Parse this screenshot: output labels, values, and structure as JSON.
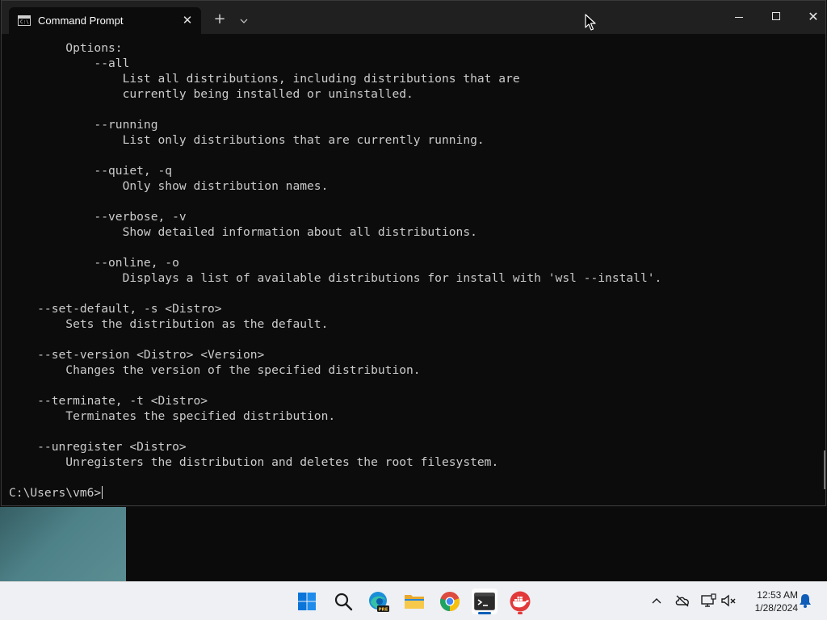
{
  "window": {
    "tab_title": "Command Prompt",
    "tab_icon_text": "C:\\"
  },
  "console": {
    "lines": [
      "        Options:",
      "            --all",
      "                List all distributions, including distributions that are",
      "                currently being installed or uninstalled.",
      "",
      "            --running",
      "                List only distributions that are currently running.",
      "",
      "            --quiet, -q",
      "                Only show distribution names.",
      "",
      "            --verbose, -v",
      "                Show detailed information about all distributions.",
      "",
      "            --online, -o",
      "                Displays a list of available distributions for install with 'wsl --install'.",
      "",
      "    --set-default, -s <Distro>",
      "        Sets the distribution as the default.",
      "",
      "    --set-version <Distro> <Version>",
      "        Changes the version of the specified distribution.",
      "",
      "    --terminate, -t <Distro>",
      "        Terminates the specified distribution.",
      "",
      "    --unregister <Distro>",
      "        Unregisters the distribution and deletes the root filesystem."
    ],
    "prompt": "C:\\Users\\vm6>"
  },
  "taskbar": {
    "apps": [
      {
        "name": "start-icon"
      },
      {
        "name": "search-icon"
      },
      {
        "name": "edge-preview-icon",
        "badge": "PRE"
      },
      {
        "name": "file-explorer-icon"
      },
      {
        "name": "chrome-icon"
      },
      {
        "name": "terminal-icon",
        "active": true
      },
      {
        "name": "docker-icon"
      }
    ],
    "tray": {
      "time": "12:53 AM",
      "date": "1/28/2024"
    }
  },
  "colors": {
    "console_bg": "#0c0c0c",
    "console_fg": "#cccccc",
    "titlebar_bg": "#202020",
    "taskbar_bg": "#eef0f4",
    "accent": "#005fb8"
  }
}
